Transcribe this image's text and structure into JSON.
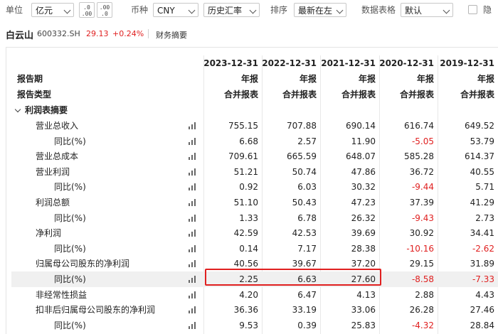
{
  "toolbar": {
    "unit_label": "单位",
    "unit_value": "亿元",
    "currency_label": "币种",
    "currency_value": "CNY",
    "rate_value": "历史汇率",
    "sort_label": "排序",
    "sort_value": "最新在左",
    "table_label": "数据表格",
    "table_value": "默认",
    "checkbox_label": "隐"
  },
  "stock": {
    "name": "白云山",
    "code": "600332.SH",
    "price": "29.13",
    "change": "+0.24%",
    "tab": "财务摘要"
  },
  "table": {
    "header_period_label": "报告期",
    "header_type_label": "报告类型",
    "periods": [
      "2023-12-31",
      "2022-12-31",
      "2021-12-31",
      "2020-12-31",
      "2019-12-31"
    ],
    "report_kind": [
      "年报",
      "年报",
      "年报",
      "年报",
      "年报"
    ],
    "report_type": [
      "合并报表",
      "合并报表",
      "合并报表",
      "合并报表",
      "合并报表"
    ],
    "section_title": "利润表摘要",
    "rows": [
      {
        "label": "营业总收入",
        "values": [
          "755.15",
          "707.88",
          "690.14",
          "616.74",
          "649.52"
        ]
      },
      {
        "label": "同比(%)",
        "values": [
          "6.68",
          "2.57",
          "11.90",
          "-5.05",
          "53.79"
        ]
      },
      {
        "label": "营业总成本",
        "values": [
          "709.61",
          "665.59",
          "648.07",
          "585.28",
          "614.37"
        ]
      },
      {
        "label": "营业利润",
        "values": [
          "51.21",
          "50.74",
          "47.86",
          "36.72",
          "40.55"
        ]
      },
      {
        "label": "同比(%)",
        "values": [
          "0.92",
          "6.03",
          "30.32",
          "-9.44",
          "5.71"
        ]
      },
      {
        "label": "利润总额",
        "values": [
          "51.10",
          "50.43",
          "47.23",
          "37.39",
          "41.29"
        ]
      },
      {
        "label": "同比(%)",
        "values": [
          "1.33",
          "6.78",
          "26.32",
          "-9.43",
          "2.73"
        ]
      },
      {
        "label": "净利润",
        "values": [
          "42.59",
          "42.53",
          "39.69",
          "30.92",
          "34.41"
        ]
      },
      {
        "label": "同比(%)",
        "values": [
          "0.14",
          "7.17",
          "28.38",
          "-10.16",
          "-2.62"
        ]
      },
      {
        "label": "归属母公司股东的净利润",
        "values": [
          "40.56",
          "39.67",
          "37.20",
          "29.15",
          "31.89"
        ]
      },
      {
        "label": "同比(%)",
        "values": [
          "2.25",
          "6.63",
          "27.60",
          "-8.58",
          "-7.33"
        ]
      },
      {
        "label": "非经常性损益",
        "values": [
          "4.20",
          "6.47",
          "4.13",
          "2.88",
          "4.43"
        ]
      },
      {
        "label": "扣非后归属母公司股东的净利润",
        "values": [
          "36.36",
          "33.19",
          "33.06",
          "26.28",
          "27.46"
        ]
      },
      {
        "label": "同比(%)",
        "values": [
          "9.53",
          "0.39",
          "25.83",
          "-4.32",
          "28.84"
        ]
      }
    ]
  },
  "colors": {
    "negative": "#e02020",
    "highlight_box": "#e02020",
    "highlight_row": "#f0f0f0"
  }
}
